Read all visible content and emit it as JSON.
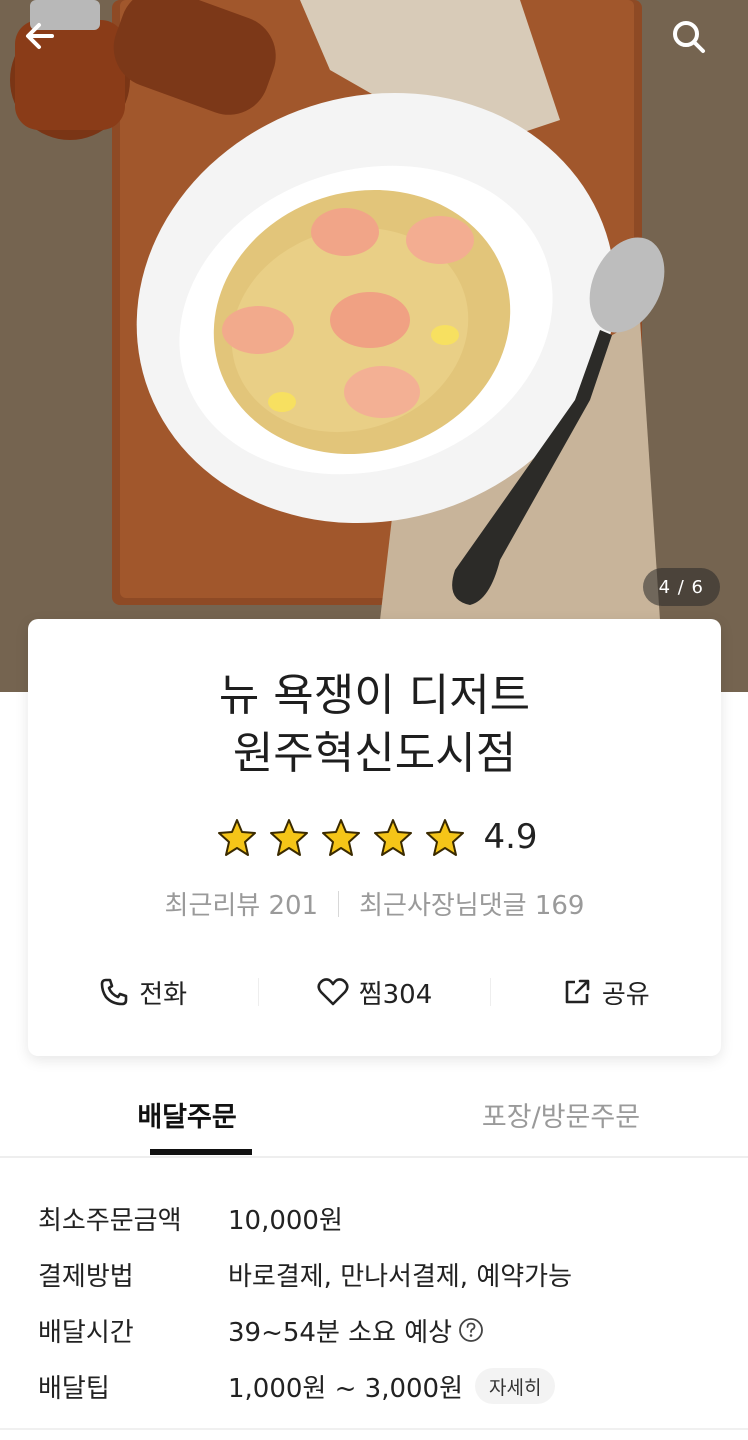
{
  "hero": {
    "photo_counter": "4 / 6",
    "icons": {
      "back": "arrow-left-icon",
      "search": "search-icon"
    }
  },
  "store": {
    "name_line1": "뉴 욕쟁이 디저트",
    "name_line2": "원주혁신도시점",
    "rating": "4.9",
    "rating_stars": 5,
    "recent_reviews": "최근리뷰 201",
    "owner_replies": "최근사장님댓글 169"
  },
  "actions": {
    "call": "전화",
    "favorite": "찜304",
    "share": "공유"
  },
  "tabs": [
    {
      "label": "배달주문",
      "active": true
    },
    {
      "label": "포장/방문주문",
      "active": false
    }
  ],
  "details": {
    "min_order_label": "최소주문금액",
    "min_order_value": "10,000원",
    "payment_label": "결제방법",
    "payment_value": "바로결제, 만나서결제, 예약가능",
    "delivery_time_label": "배달시간",
    "delivery_time_value": "39~54분 소요 예상",
    "delivery_tip_label": "배달팁",
    "delivery_tip_value": "1,000원 ~ 3,000원",
    "delivery_tip_button": "자세히"
  },
  "colors": {
    "star": "#f5c518",
    "text_primary": "#222222",
    "text_secondary": "#9a9a9a"
  }
}
